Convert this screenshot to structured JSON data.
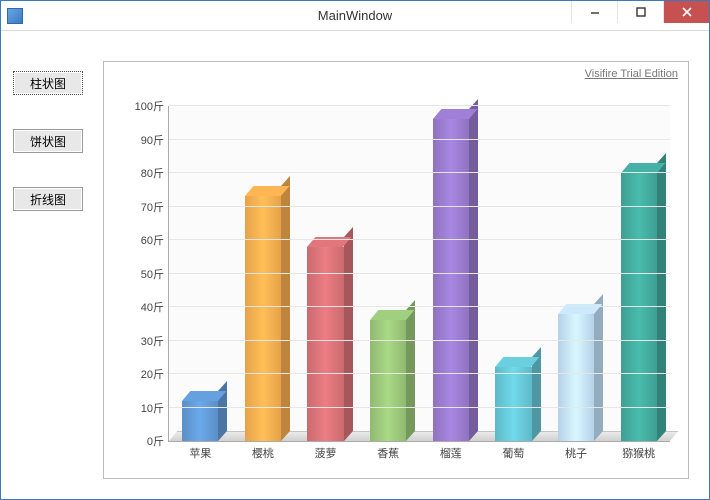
{
  "window": {
    "title": "MainWindow"
  },
  "sidebar": {
    "items": [
      {
        "label": "柱状图",
        "selected": true
      },
      {
        "label": "饼状图",
        "selected": false
      },
      {
        "label": "折线图",
        "selected": false
      }
    ]
  },
  "watermark": "Visifire Trial Edition",
  "chart_data": {
    "type": "bar",
    "title": "",
    "xlabel": "",
    "ylabel": "",
    "y_unit": "斤",
    "ylim": [
      0,
      100
    ],
    "yticks": [
      0,
      10,
      20,
      30,
      40,
      50,
      60,
      70,
      80,
      90,
      100
    ],
    "categories": [
      "苹果",
      "樱桃",
      "菠萝",
      "香蕉",
      "榴莲",
      "葡萄",
      "桃子",
      "猕猴桃"
    ],
    "values": [
      12,
      73,
      58,
      36,
      96,
      22,
      38,
      80
    ],
    "colors": [
      "#5B8FC7",
      "#E6A24A",
      "#C96A6F",
      "#8FB971",
      "#8F72C0",
      "#5FB9C7",
      "#B6D1E8",
      "#3E9F93"
    ]
  }
}
